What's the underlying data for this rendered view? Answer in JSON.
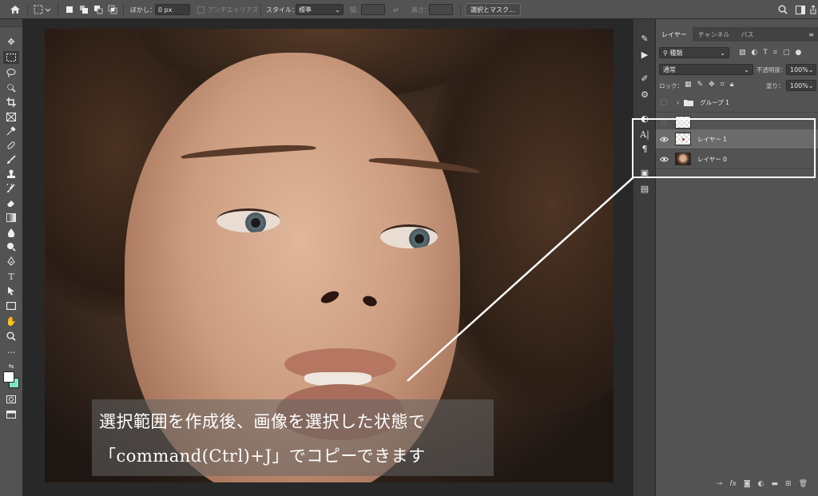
{
  "options_bar": {
    "feather_label": "ぼかし：",
    "feather_value": "0 px",
    "antialias_label": "アンチエイリアス",
    "style_label": "スタイル：",
    "style_value": "標準",
    "width_label": "幅：",
    "height_label": "高さ：",
    "select_mask_button": "選択とマスク..."
  },
  "caption": {
    "line1": "選択範囲を作成後、画像を選択した状態で",
    "line2": "「command(Ctrl)+J」でコピーできます"
  },
  "layers_panel": {
    "tabs": [
      "レイヤー",
      "チャンネル",
      "パス"
    ],
    "filter_label": "種類",
    "blend_mode": "通常",
    "opacity_label": "不透明度：",
    "opacity_value": "100%",
    "lock_label": "ロック：",
    "fill_label": "塗り：",
    "fill_value": "100%",
    "layers": [
      {
        "name": "グループ 1",
        "type": "group",
        "visible": false
      },
      {
        "name": "",
        "type": "shape",
        "visible": false
      },
      {
        "name": "レイヤー 1",
        "type": "pixel",
        "visible": true,
        "selected": true
      },
      {
        "name": "レイヤー 0",
        "type": "photo",
        "visible": true,
        "selected": false
      }
    ]
  },
  "icons": [
    "home-icon",
    "marquee-icon",
    "move-icon",
    "lasso-icon",
    "crop-icon",
    "eyedropper-icon",
    "brush-icon",
    "eraser-icon",
    "gradient-icon",
    "pen-icon",
    "type-icon",
    "hand-icon",
    "zoom-icon",
    "search-icon",
    "eye-icon",
    "lock-icon",
    "fx-icon",
    "trash-icon"
  ]
}
